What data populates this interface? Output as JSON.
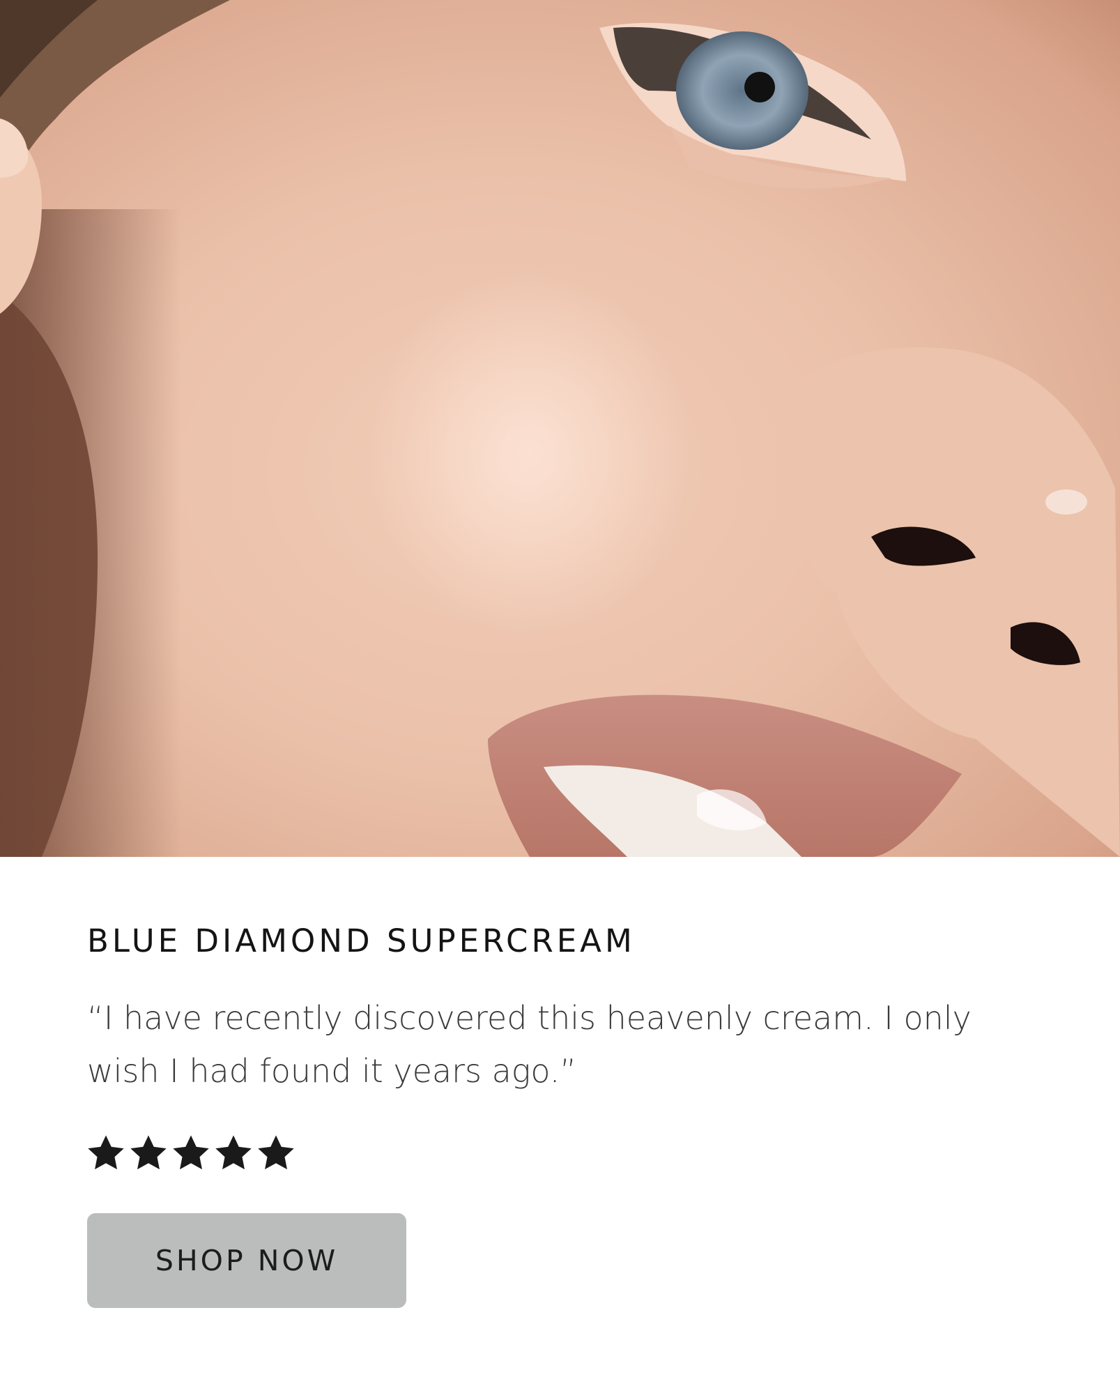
{
  "hero": {
    "alt": "Close-up of a woman's face showing cheek, eye, nose and lips"
  },
  "product": {
    "name": "BLUE DIAMOND SUPERCREAM",
    "quote": "“I have recently discovered this heavenly cream. I only wish I had found it years ago.”",
    "rating": 5,
    "rating_max": 5,
    "star_icon": "star-icon",
    "star_color": "#1a1a1a"
  },
  "cta": {
    "label": "SHOP NOW",
    "background": "#bbbcbc"
  }
}
